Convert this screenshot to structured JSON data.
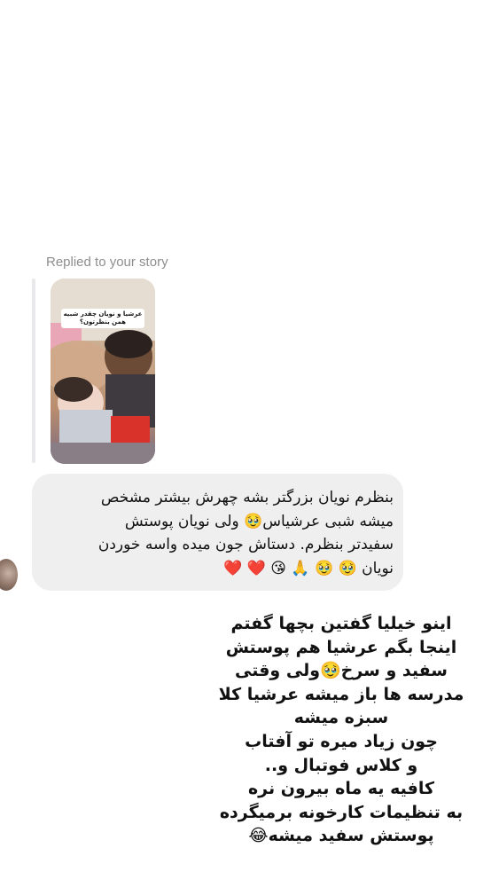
{
  "reply_header": {
    "label": "Replied to your story"
  },
  "story": {
    "caption": "عرشیا و نویان چقدر شبیه همن بنظرتون؟"
  },
  "message": {
    "text": "بنظرم نویان بزرگتر بشه چهرش بیشتر مشخص\nمیشه شبی عرشیاس🥹  ولی نویان پوستش\nسفیدتر بنظرم. دستاش جون میده واسه خوردن\nنویان 🥹 🥹 🙏 😘 ❤️ ❤️"
  },
  "overlay": {
    "text": "اینو خیلیا گفتین بچها گفتم\nاینجا بگم عرشیا هم پوستش\nسفید و سرخ🥹ولی وقتی\nمدرسه ها باز میشه عرشیا کلا\nسبزه میشه\nچون زیاد میره تو آفتاب\nو کلاس فوتبال و..\nکافیه یه ماه بیرون نره\nبه تنظیمات کارخونه برمیگرده\nپوستش سفید میشه😂"
  }
}
